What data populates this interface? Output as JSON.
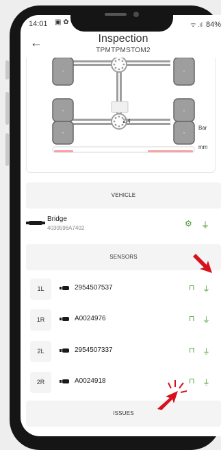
{
  "status_bar": {
    "time": "14:01",
    "left_icons": "▣ ✿",
    "signal": "ᯤ .ıl",
    "battery": "84%"
  },
  "header": {
    "title": "Inspection",
    "subtitle": "TPMTPMSTOM2",
    "back_icon": "←"
  },
  "diagram": {
    "pressure_unit": "Bar",
    "depth_unit": "mm",
    "axle_value": "2.4",
    "wheel_placeholder": "-"
  },
  "sections": {
    "vehicle": "VEHICLE",
    "sensors": "SENSORS",
    "issues": "ISSUES"
  },
  "vehicle": {
    "name": "Bridge",
    "id": "4030596A7402",
    "icons": [
      "truck-icon",
      "gear-icon",
      "plug-icon"
    ]
  },
  "sensors": [
    {
      "position": "1L",
      "serial": "2954507537"
    },
    {
      "position": "1R",
      "serial": "A0024976"
    },
    {
      "position": "2L",
      "serial": "2954507337"
    },
    {
      "position": "2R",
      "serial": "A0024918"
    }
  ],
  "colors": {
    "accent_green": "#4a9a2f",
    "arrow_red": "#d6121d",
    "section_bg": "#f4f4f4",
    "tire_gray": "#9e9e9e"
  }
}
